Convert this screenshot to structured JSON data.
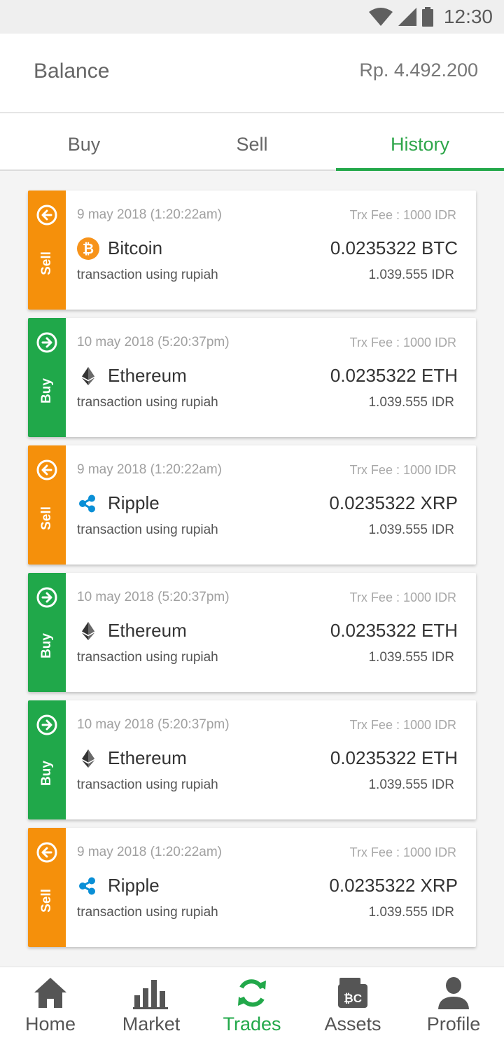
{
  "status_bar": {
    "time": "12:30"
  },
  "balance": {
    "label": "Balance",
    "value": "Rp. 4.492.200"
  },
  "tabs": [
    {
      "label": "Buy",
      "active": false
    },
    {
      "label": "Sell",
      "active": false
    },
    {
      "label": "History",
      "active": true
    }
  ],
  "colors": {
    "sell": "#f5900b",
    "buy": "#20a84a",
    "accent": "#22a84a"
  },
  "transactions": [
    {
      "type": "sell",
      "type_label": "Sell",
      "date": "9 may 2018 (1:20:22am)",
      "fee": "Trx Fee : 1000 IDR",
      "coin_icon": "bitcoin-icon",
      "coin": "Bitcoin",
      "amount": "0.0235322 BTC",
      "note": "transaction using rupiah",
      "idr": "1.039.555 IDR"
    },
    {
      "type": "buy",
      "type_label": "Buy",
      "date": "10 may 2018 (5:20:37pm)",
      "fee": "Trx Fee : 1000 IDR",
      "coin_icon": "ethereum-icon",
      "coin": "Ethereum",
      "amount": "0.0235322 ETH",
      "note": "transaction using rupiah",
      "idr": "1.039.555 IDR"
    },
    {
      "type": "sell",
      "type_label": "Sell",
      "date": "9 may 2018 (1:20:22am)",
      "fee": "Trx Fee : 1000 IDR",
      "coin_icon": "ripple-icon",
      "coin": "Ripple",
      "amount": "0.0235322 XRP",
      "note": "transaction using rupiah",
      "idr": "1.039.555 IDR"
    },
    {
      "type": "buy",
      "type_label": "Buy",
      "date": "10 may 2018 (5:20:37pm)",
      "fee": "Trx Fee : 1000 IDR",
      "coin_icon": "ethereum-icon",
      "coin": "Ethereum",
      "amount": "0.0235322 ETH",
      "note": "transaction using rupiah",
      "idr": "1.039.555 IDR"
    },
    {
      "type": "buy",
      "type_label": "Buy",
      "date": "10 may 2018 (5:20:37pm)",
      "fee": "Trx Fee : 1000 IDR",
      "coin_icon": "ethereum-icon",
      "coin": "Ethereum",
      "amount": "0.0235322 ETH",
      "note": "transaction using rupiah",
      "idr": "1.039.555 IDR"
    },
    {
      "type": "sell",
      "type_label": "Sell",
      "date": "9 may 2018 (1:20:22am)",
      "fee": "Trx Fee : 1000 IDR",
      "coin_icon": "ripple-icon",
      "coin": "Ripple",
      "amount": "0.0235322 XRP",
      "note": "transaction using rupiah",
      "idr": "1.039.555 IDR"
    }
  ],
  "bottom_nav": [
    {
      "label": "Home",
      "icon": "home-icon",
      "active": false
    },
    {
      "label": "Market",
      "icon": "bar-chart-icon",
      "active": false
    },
    {
      "label": "Trades",
      "icon": "refresh-icon",
      "active": true
    },
    {
      "label": "Assets",
      "icon": "wallet-icon",
      "active": false
    },
    {
      "label": "Profile",
      "icon": "user-icon",
      "active": false
    }
  ]
}
